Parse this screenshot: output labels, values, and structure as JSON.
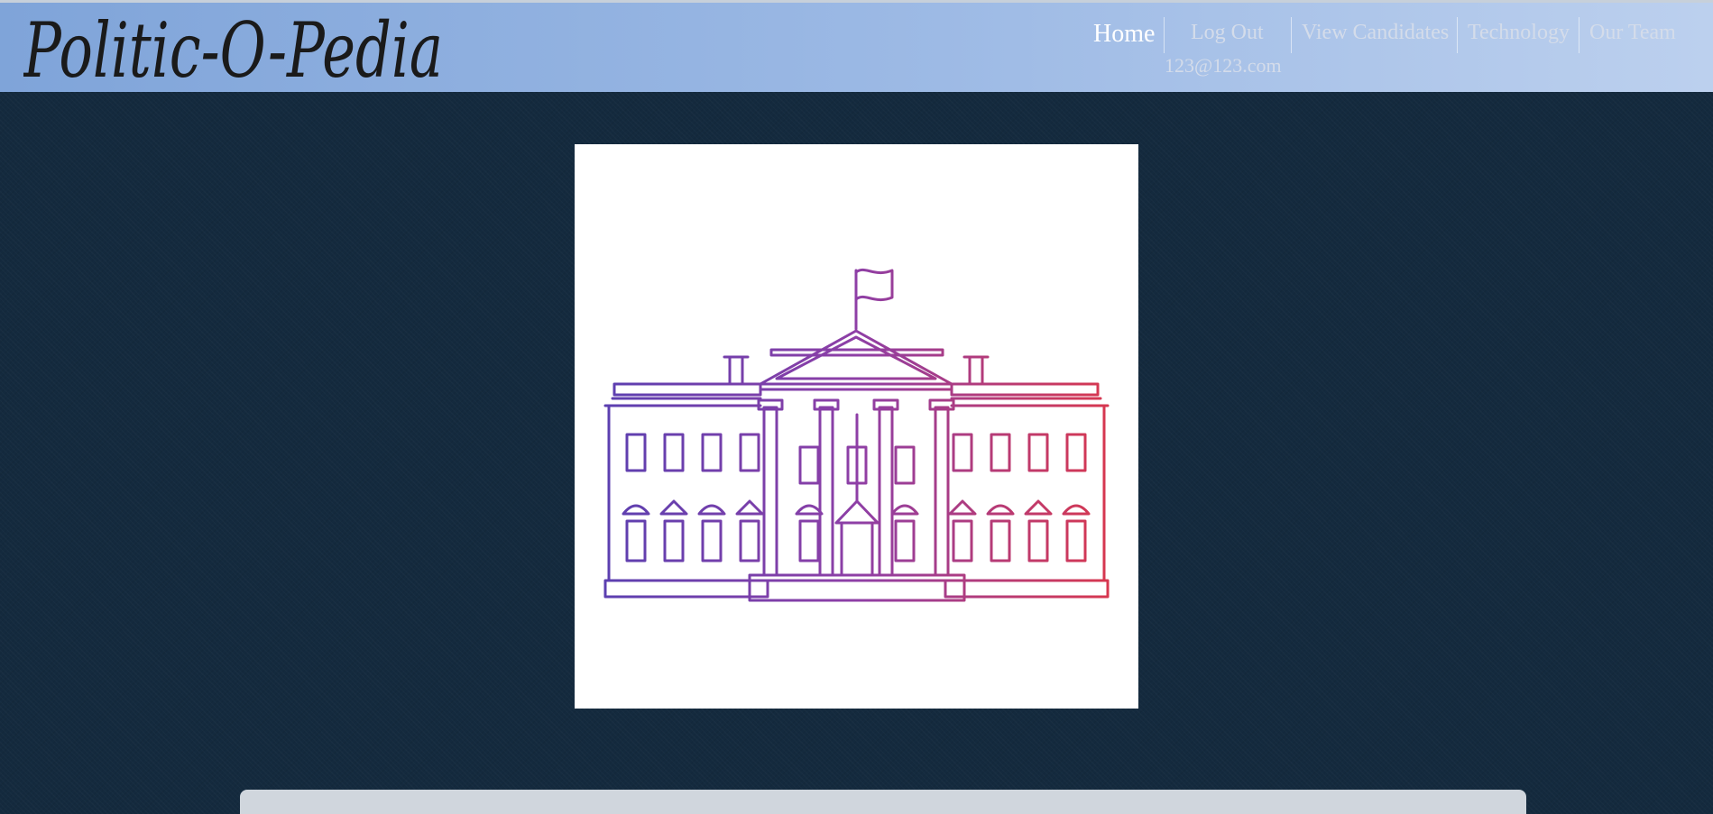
{
  "header": {
    "logo_text": "Politic-O-Pedia",
    "nav": {
      "home": "Home",
      "logout": "Log Out",
      "view_candidates": "View Candidates",
      "technology": "Technology",
      "our_team": "Our Team"
    },
    "user_email": "123@123.com"
  },
  "hero": {
    "icon": "white-house-icon",
    "gradient_start": "#5b3fb0",
    "gradient_end": "#d8374e"
  },
  "colors": {
    "header_start": "#7fa4d9",
    "header_end": "#bcd0ee",
    "page_background": "#142a3e",
    "panel": "#d0d6dd"
  }
}
